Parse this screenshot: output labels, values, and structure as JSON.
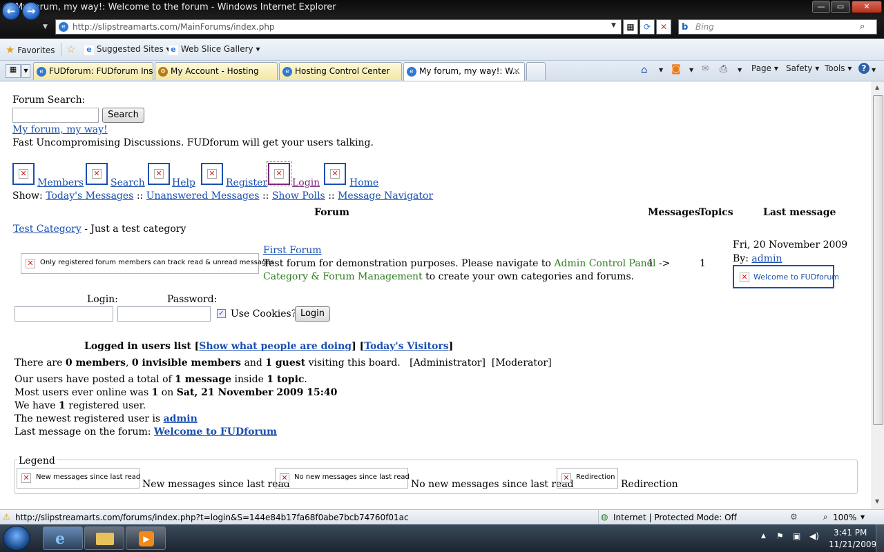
{
  "window": {
    "title": "My forum, my way!: Welcome to the forum - Windows Internet Explorer",
    "min": "—",
    "max": "▭",
    "close": "✕"
  },
  "address": {
    "url": "http://slipstreamarts.com/MainForums/index.php",
    "search_placeholder": "Bing"
  },
  "favorites": {
    "label": "Favorites",
    "suggested": "Suggested Sites ▾",
    "webslice": "Web Slice Gallery ▾"
  },
  "tabs": [
    {
      "label": "FUDforum: FUDforum Inst..."
    },
    {
      "label": "My Account - Hosting"
    },
    {
      "label": "Hosting Control Center"
    },
    {
      "label": "My forum, my way!: W..."
    }
  ],
  "commands": {
    "page": "Page ▾",
    "safety": "Safety ▾",
    "tools": "Tools ▾"
  },
  "forum": {
    "search_label": "Forum Search:",
    "search_button": "Search",
    "site_name": "My forum, my way!",
    "tagline": "Fast Uncompromising Discussions. FUDforum will get your users talking.",
    "nav": {
      "members": "Members",
      "search": "Search",
      "help": "Help",
      "register": "Register",
      "login": "Login",
      "home": "Home"
    },
    "show_label": "Show:",
    "show_links": {
      "todays": "Today's Messages",
      "unanswered": "Unanswered Messages",
      "polls": "Show Polls",
      "navigator": "Message Navigator"
    },
    "sep": "::",
    "table_headers": {
      "forum": "Forum",
      "messages": "Messages",
      "topics": "Topics",
      "last": "Last message"
    },
    "category": {
      "name": "Test Category",
      "desc": "- Just a test category"
    },
    "row": {
      "track_note": "Only registered forum members can track read & unread messages",
      "name": "First Forum",
      "desc_1": "Test forum for demonstration purposes. Please navigate to",
      "link_1": "Admin Control Panel",
      "arrow": "->",
      "link_2": "Category & Forum Management",
      "desc_2": "to create your own categories and forums.",
      "messages": "1",
      "topics": "1",
      "last_date": "Fri, 20 November 2009",
      "by": "By:",
      "last_user": "admin",
      "last_title": "Welcome to FUDforum"
    },
    "login": {
      "login_label": "Login:",
      "password_label": "Password:",
      "cookies": "Use Cookies?",
      "button": "Login"
    },
    "users": {
      "list_title": "Logged in users list",
      "lb1": "[",
      "show_doing": "Show what people are doing",
      "rb1": "]",
      "lb2": "[",
      "todays_visitors": "Today's Visitors",
      "rb2": "]",
      "there_are": "There are",
      "members": "0 members",
      "comma": ",",
      "invisible": "0 invisible members",
      "and": "and",
      "guests": "1 guest",
      "visiting": "visiting this board.",
      "admin_tag": "[Administrator]",
      "mod_tag": "[Moderator]",
      "posted_1": "Our users have posted a total of",
      "posted_n": "1 message",
      "posted_2": "inside",
      "posted_t": "1 topic",
      "posted_3": ".",
      "most_1": "Most users ever online was",
      "most_n": "1",
      "most_2": "on",
      "most_date": "Sat, 21 November 2009 15:40",
      "reg_1": "We have",
      "reg_n": "1",
      "reg_2": "registered user.",
      "newest_1": "The newest registered user is",
      "newest_user": "admin",
      "last_1": "Last message on the forum:",
      "last_msg": "Welcome to FUDforum"
    },
    "legend": {
      "title": "Legend",
      "items": [
        {
          "img": "New messages since last read",
          "text": "New messages since last read"
        },
        {
          "img": "No new messages since last read",
          "text": "No new messages since last read"
        },
        {
          "img": "Redirection",
          "text": "Redirection"
        }
      ]
    }
  },
  "status": {
    "url": "http://slipstreamarts.com/forums/index.php?t=login&S=144e84b17fa68f0abe7bcb74760f01ac",
    "zone": "Internet | Protected Mode: Off",
    "zoom": "100%"
  },
  "clock": {
    "time": "3:41 PM",
    "date": "11/21/2009"
  }
}
